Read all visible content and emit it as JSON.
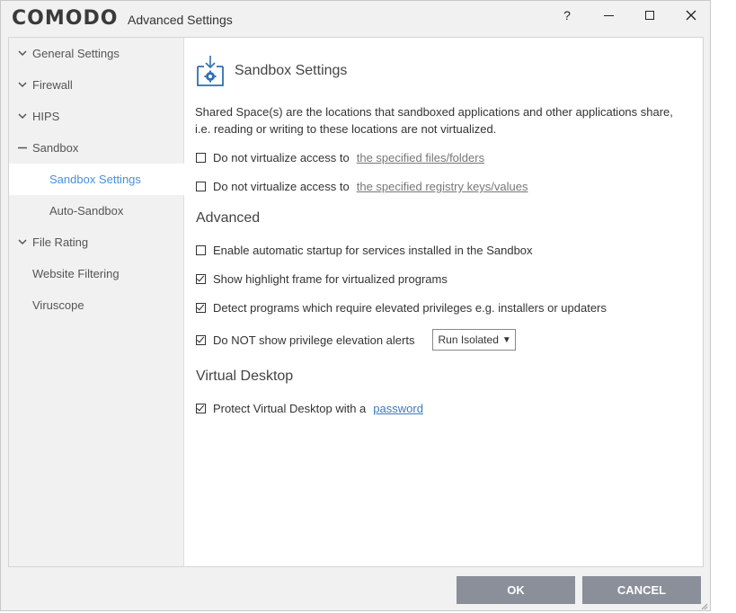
{
  "window": {
    "brand": "COMODO",
    "title": "Advanced Settings",
    "help_label": "?"
  },
  "sidebar": {
    "items": [
      {
        "label": "General Settings",
        "icon": "chevron-down-icon"
      },
      {
        "label": "Firewall",
        "icon": "chevron-down-icon"
      },
      {
        "label": "HIPS",
        "icon": "chevron-down-icon"
      },
      {
        "label": "Sandbox",
        "icon": "collapse-dash-icon"
      },
      {
        "label": "Sandbox Settings",
        "selected": true
      },
      {
        "label": "Auto-Sandbox"
      },
      {
        "label": "File Rating",
        "icon": "chevron-down-icon"
      },
      {
        "label": "Website Filtering"
      },
      {
        "label": "Viruscope"
      }
    ]
  },
  "main": {
    "heading": "Sandbox Settings",
    "heading_icon": "sandbox-settings-icon",
    "description": "Shared Space(s) are the locations that sandboxed applications and other applications share, i.e. reading or writing to these locations are not virtualized.",
    "shared": [
      {
        "label": "Do not virtualize access to",
        "link": "the specified files/folders",
        "checked": false
      },
      {
        "label": "Do not virtualize access to",
        "link": "the specified registry keys/values",
        "checked": false
      }
    ],
    "advanced_title": "Advanced",
    "advanced": [
      {
        "label": "Enable automatic startup for services installed in the Sandbox",
        "checked": false
      },
      {
        "label": "Show highlight frame for virtualized programs",
        "checked": true
      },
      {
        "label": "Detect programs which require elevated privileges e.g. installers or updaters",
        "checked": true
      },
      {
        "label": "Do NOT show privilege elevation alerts",
        "checked": true,
        "dropdown": "Run Isolated"
      }
    ],
    "vd_title": "Virtual Desktop",
    "vd": {
      "label": "Protect Virtual Desktop with a",
      "link": "password",
      "checked": true
    }
  },
  "buttons": {
    "ok": "OK",
    "cancel": "CANCEL"
  },
  "colors": {
    "accent": "#4a90d9",
    "button_bg": "#8a8f99",
    "link_blue": "#3a7bbf"
  }
}
